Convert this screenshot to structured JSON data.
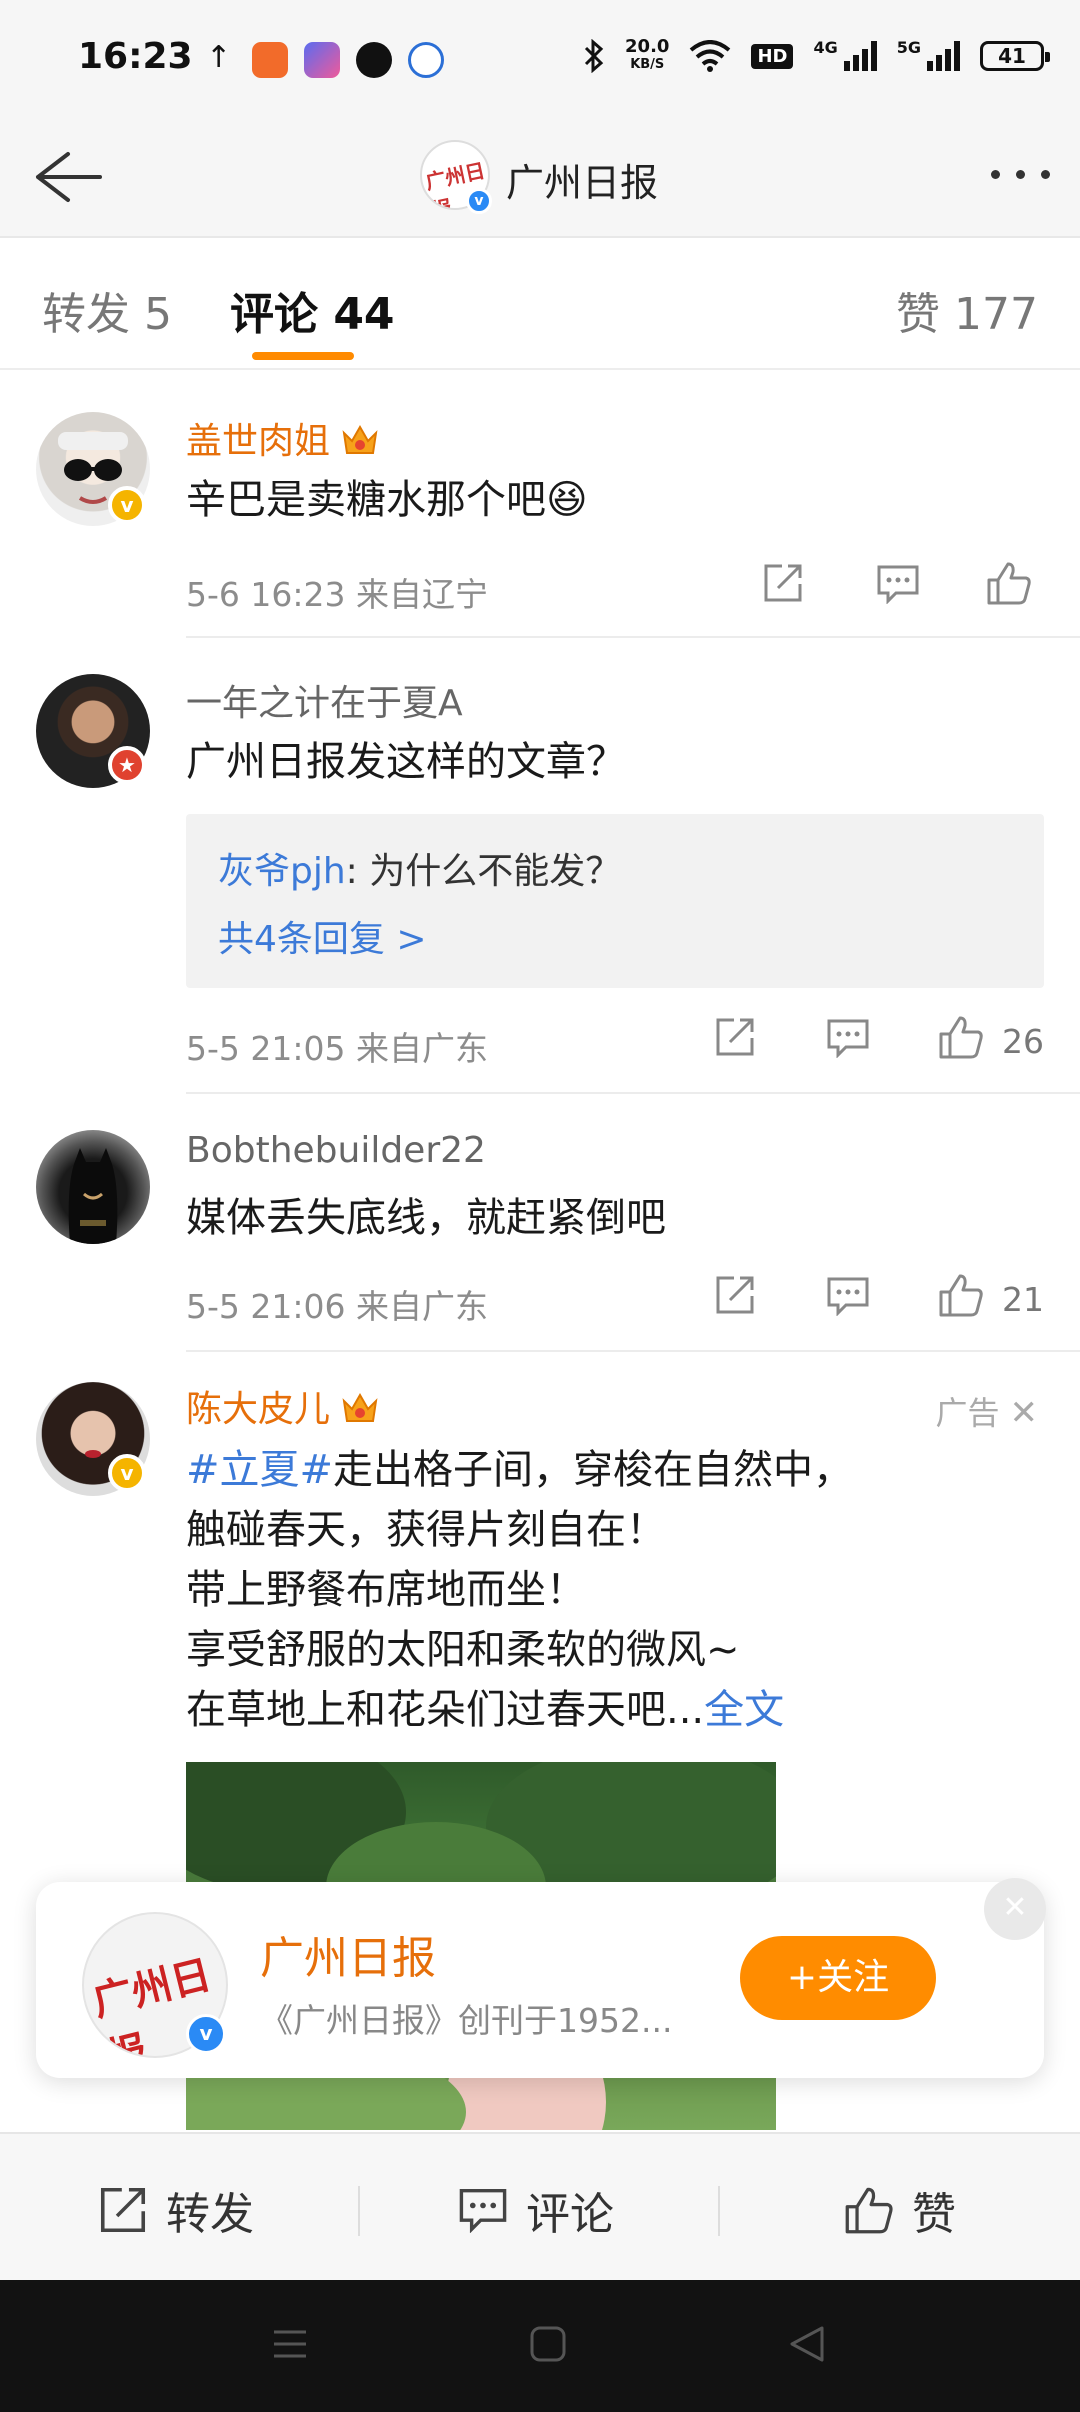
{
  "status_bar": {
    "time": "16:23",
    "upload_arrow": "↑",
    "speed_value": "20.0",
    "speed_unit": "KB/S",
    "hd": "HD",
    "net1": "4G",
    "net2": "5G",
    "battery": "41"
  },
  "nav": {
    "title": "广州日报",
    "avatar_text": "广州日报"
  },
  "tabs": {
    "repost": "转发 5",
    "comments": "评论 44",
    "likes": "赞 177"
  },
  "comments": [
    {
      "user": "盖世肉姐",
      "text": "辛巴是卖糖水那个吧😆",
      "meta": "5-6 16:23  来自辽宁",
      "likes": ""
    },
    {
      "user": "一年之计在于夏A",
      "text": "广州日报发这样的文章？",
      "reply_user": "灰爷pjh",
      "reply_text": ": 为什么不能发？",
      "reply_more": "共4条回复 >",
      "meta": "5-5 21:05  来自广东",
      "likes": "26"
    },
    {
      "user": "Bobthebuilder22",
      "text": "媒体丢失底线，就赶紧倒吧",
      "meta": "5-5 21:06  来自广东",
      "likes": "21"
    }
  ],
  "ad": {
    "user": "陈大皮儿",
    "label": "广告",
    "hashtag": "#立夏#",
    "line1": "走出格子间，穿梭在自然中，",
    "line2": "触碰春天，获得片刻自在！",
    "line3": "带上野餐布席地而坐！",
    "line4": "享受舒服的太阳和柔软的微风~",
    "line5": "在草地上和花朵们过春天吧...",
    "full_text": "全文"
  },
  "follow_card": {
    "name": "广州日报",
    "desc": "《广州日报》创刊于1952...",
    "button": "+关注",
    "avatar_text": "广州日报"
  },
  "bottom_bar": {
    "repost": "转发",
    "comment": "评论",
    "like": "赞"
  },
  "colors": {
    "accent_orange": "#ff8c00",
    "link_blue": "#3c7ad8",
    "vip_name": "#e66f0a",
    "verify_yellow": "#f5b400",
    "verify_blue": "#2a8af5"
  }
}
